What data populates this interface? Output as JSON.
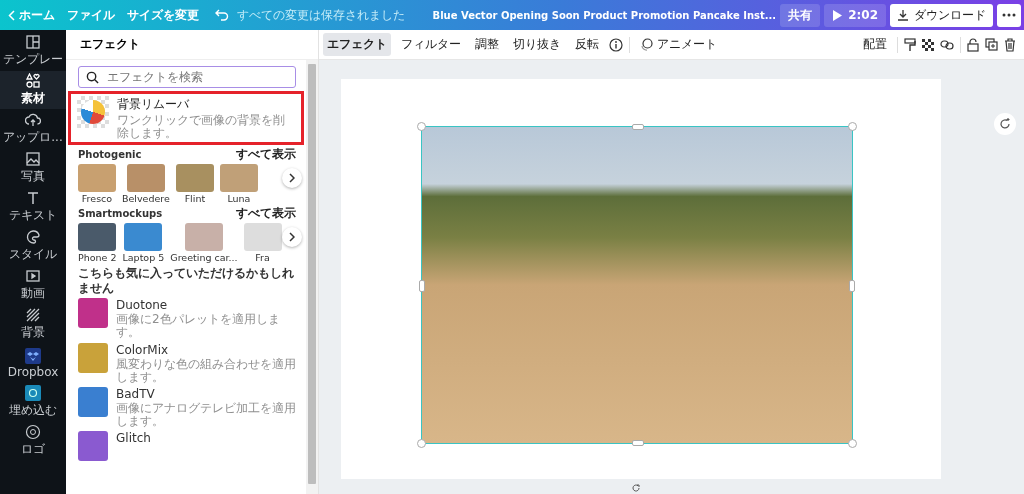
{
  "topbar": {
    "home": "ホーム",
    "menu": [
      "ファイル",
      "サイズを変更"
    ],
    "save_status": "すべての変更は保存されました",
    "title": "Blue Vector Opening Soon Product Promotion Pancake Inst...",
    "share": "共有",
    "play_time": "2:02",
    "download": "ダウンロード"
  },
  "sidebar": {
    "items": [
      {
        "label": "テンプレー",
        "selected": false,
        "kind": "template"
      },
      {
        "label": "素材",
        "selected": true,
        "kind": "elements"
      },
      {
        "label": "アップロ...",
        "selected": false,
        "kind": "upload"
      },
      {
        "label": "写真",
        "selected": false,
        "kind": "photo"
      },
      {
        "label": "テキスト",
        "selected": false,
        "kind": "text"
      },
      {
        "label": "スタイル",
        "selected": false,
        "kind": "style"
      },
      {
        "label": "動画",
        "selected": false,
        "kind": "video"
      },
      {
        "label": "背景",
        "selected": false,
        "kind": "background"
      },
      {
        "label": "Dropbox",
        "selected": false,
        "kind": "dropbox"
      },
      {
        "label": "埋め込む",
        "selected": false,
        "kind": "embed"
      },
      {
        "label": "ロゴ",
        "selected": false,
        "kind": "logo"
      }
    ]
  },
  "panel": {
    "title": "エフェクト",
    "search": {
      "placeholder": "エフェクトを検索"
    },
    "featured": {
      "name": "背景リムーバ",
      "description": "ワンクリックで画像の背景を削除します。"
    },
    "sections": [
      {
        "title": "Photogenic",
        "see_all": "すべて表示",
        "items": [
          "Fresco",
          "Belvedere",
          "Flint",
          "Luna"
        ]
      },
      {
        "title": "Smartmockups",
        "see_all": "すべて表示",
        "items": [
          "Phone 2",
          "Laptop 5",
          "Greeting car...",
          "Fra"
        ]
      }
    ],
    "suggest_title": "こちらも気に入っていただけるかもしれません",
    "suggestions": [
      {
        "name": "Duotone",
        "description": "画像に2色パレットを適用します。",
        "color": "#c0308a"
      },
      {
        "name": "ColorMix",
        "description": "風変わりな色の組み合わせを適用します。",
        "color": "#c9a23a"
      },
      {
        "name": "BadTV",
        "description": "画像にアナログテレビ加工を適用します。",
        "color": "#3a7fd0"
      },
      {
        "name": "Glitch",
        "color": "#8a5ad0"
      }
    ]
  },
  "toolbar": {
    "tabs": [
      {
        "label": "エフェクト",
        "selected": true
      },
      {
        "label": "フィルター",
        "selected": false
      },
      {
        "label": "調整",
        "selected": false
      },
      {
        "label": "切り抜き",
        "selected": false
      },
      {
        "label": "反転",
        "selected": false
      }
    ],
    "animate": "アニメート",
    "arrange": "配置"
  }
}
